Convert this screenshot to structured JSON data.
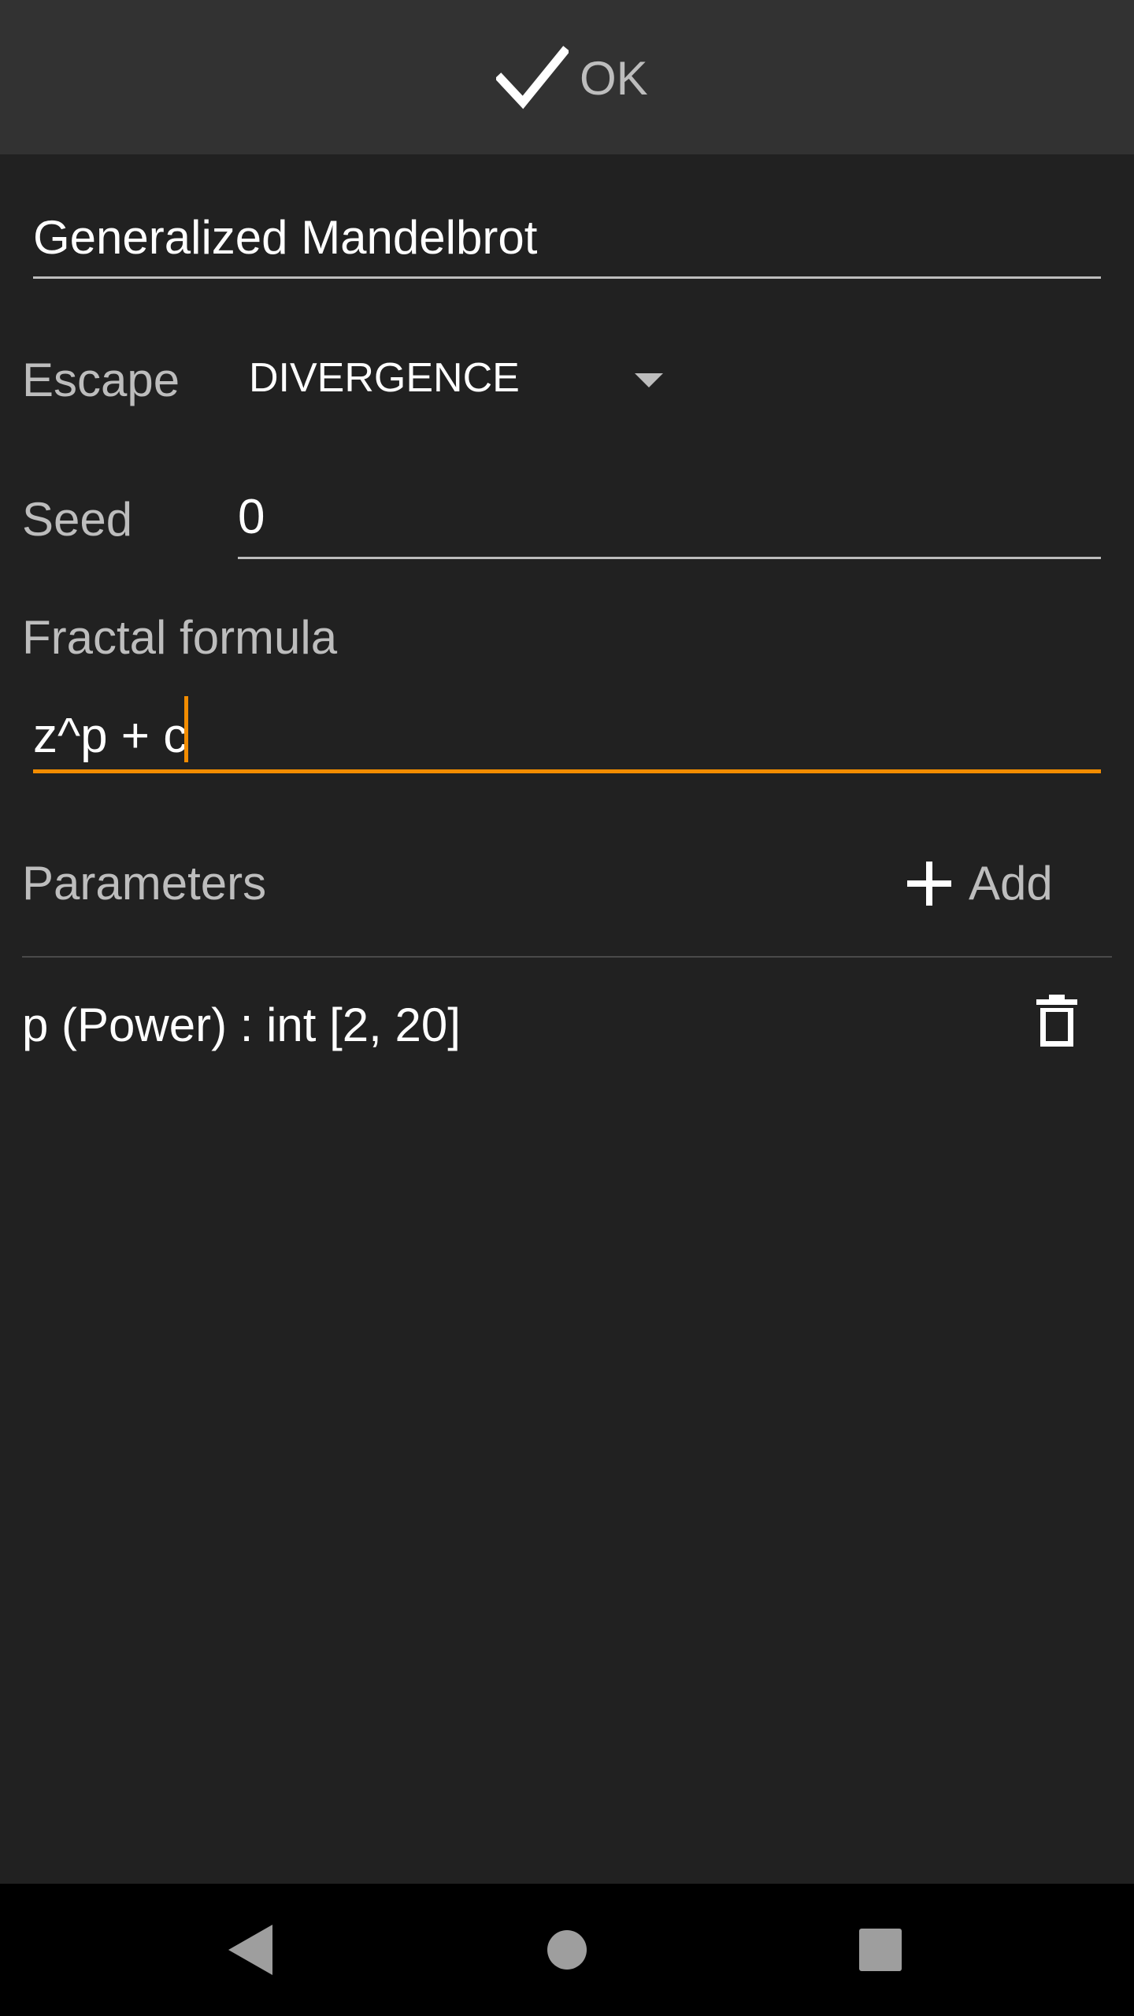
{
  "toolbar": {
    "ok_label": "OK"
  },
  "form": {
    "name_value": "Generalized Mandelbrot",
    "escape_label": "Escape",
    "escape_value": "DIVERGENCE",
    "seed_label": "Seed",
    "seed_value": "0",
    "formula_label": "Fractal formula",
    "formula_value": "z^p + c"
  },
  "parameters": {
    "heading": "Parameters",
    "add_label": "Add",
    "items": [
      {
        "label": "p (Power) : int [2, 20]"
      }
    ]
  },
  "icons": {
    "ok": "check-icon",
    "dropdown": "triangle-down-icon",
    "add": "plus-icon",
    "delete": "trash-icon",
    "nav_back": "back-triangle-icon",
    "nav_home": "home-circle-icon",
    "nav_recents": "recents-square-icon"
  },
  "colors": {
    "accent": "#f28c00",
    "background": "#212121",
    "toolbar": "#323232",
    "navbar": "#000000"
  }
}
